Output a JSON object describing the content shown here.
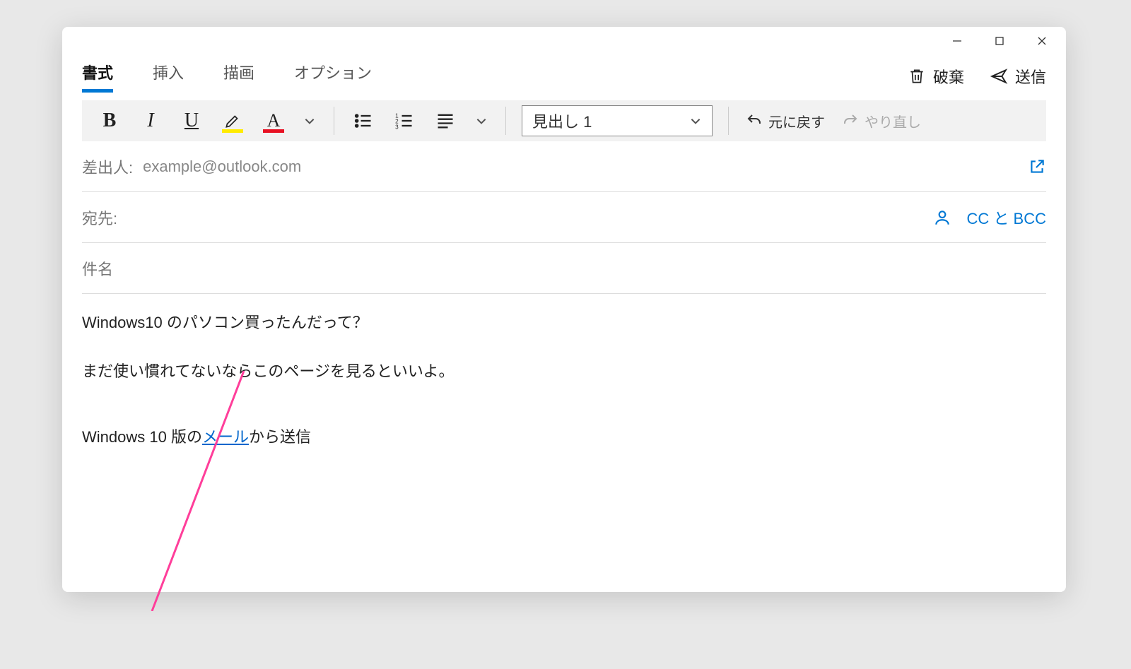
{
  "tabs": {
    "items": [
      "書式",
      "挿入",
      "描画",
      "オプション"
    ],
    "active": 0
  },
  "actions": {
    "discard": "破棄",
    "send": "送信"
  },
  "toolbar": {
    "style_selected": "見出し 1",
    "undo": "元に戻す",
    "redo": "やり直し"
  },
  "fields": {
    "from_label": "差出人:",
    "from_value": "example@outlook.com",
    "to_label": "宛先:",
    "cc_bcc": "CC と BCC",
    "subject_placeholder": "件名"
  },
  "body": {
    "line1": "Windows10 のパソコン買ったんだって？",
    "line2": "まだ使い慣れてないならこのページを見るといいよ。",
    "sig_pre": "Windows 10 版の",
    "sig_link": "メール",
    "sig_post": "から送信"
  }
}
